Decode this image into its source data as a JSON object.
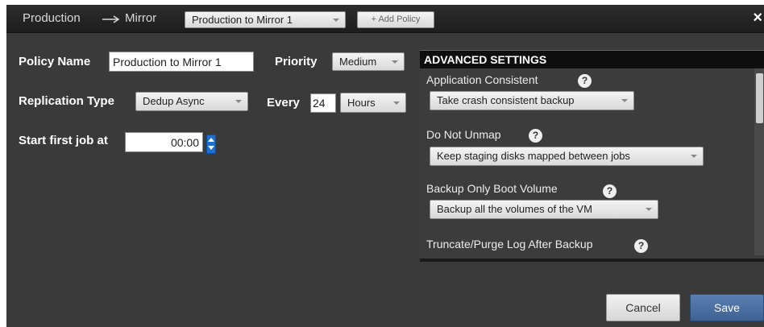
{
  "title": {
    "source": "Production",
    "target": "Mirror"
  },
  "header": {
    "policy_select": "Production to Mirror 1",
    "add_policy": "+ Add Policy",
    "close": "×"
  },
  "form": {
    "policy_name_label": "Policy Name",
    "policy_name_value": "Production to Mirror 1",
    "priority_label": "Priority",
    "priority_value": "Medium",
    "replication_type_label": "Replication Type",
    "replication_type_value": "Dedup Async",
    "every_label": "Every",
    "every_value": "24",
    "every_unit": "Hours",
    "start_label": "Start first job at",
    "start_value": "00:00"
  },
  "advanced": {
    "heading": "ADVANCED SETTINGS",
    "items": [
      {
        "label": "Application Consistent",
        "value": "Take crash consistent backup"
      },
      {
        "label": "Do Not Unmap",
        "value": "Keep staging disks mapped between jobs"
      },
      {
        "label": "Backup Only Boot Volume",
        "value": "Backup all the volumes of the VM"
      },
      {
        "label": "Truncate/Purge Log After Backup"
      }
    ]
  },
  "footer": {
    "cancel": "Cancel",
    "save": "Save"
  },
  "icons": {
    "help": "question-icon",
    "close": "close-icon",
    "arrow": "right-arrow-icon"
  },
  "colors": {
    "save_button": "#4a6fa0",
    "spinner": "#1e6fd0",
    "panel_bg": "#3a3a3a"
  }
}
